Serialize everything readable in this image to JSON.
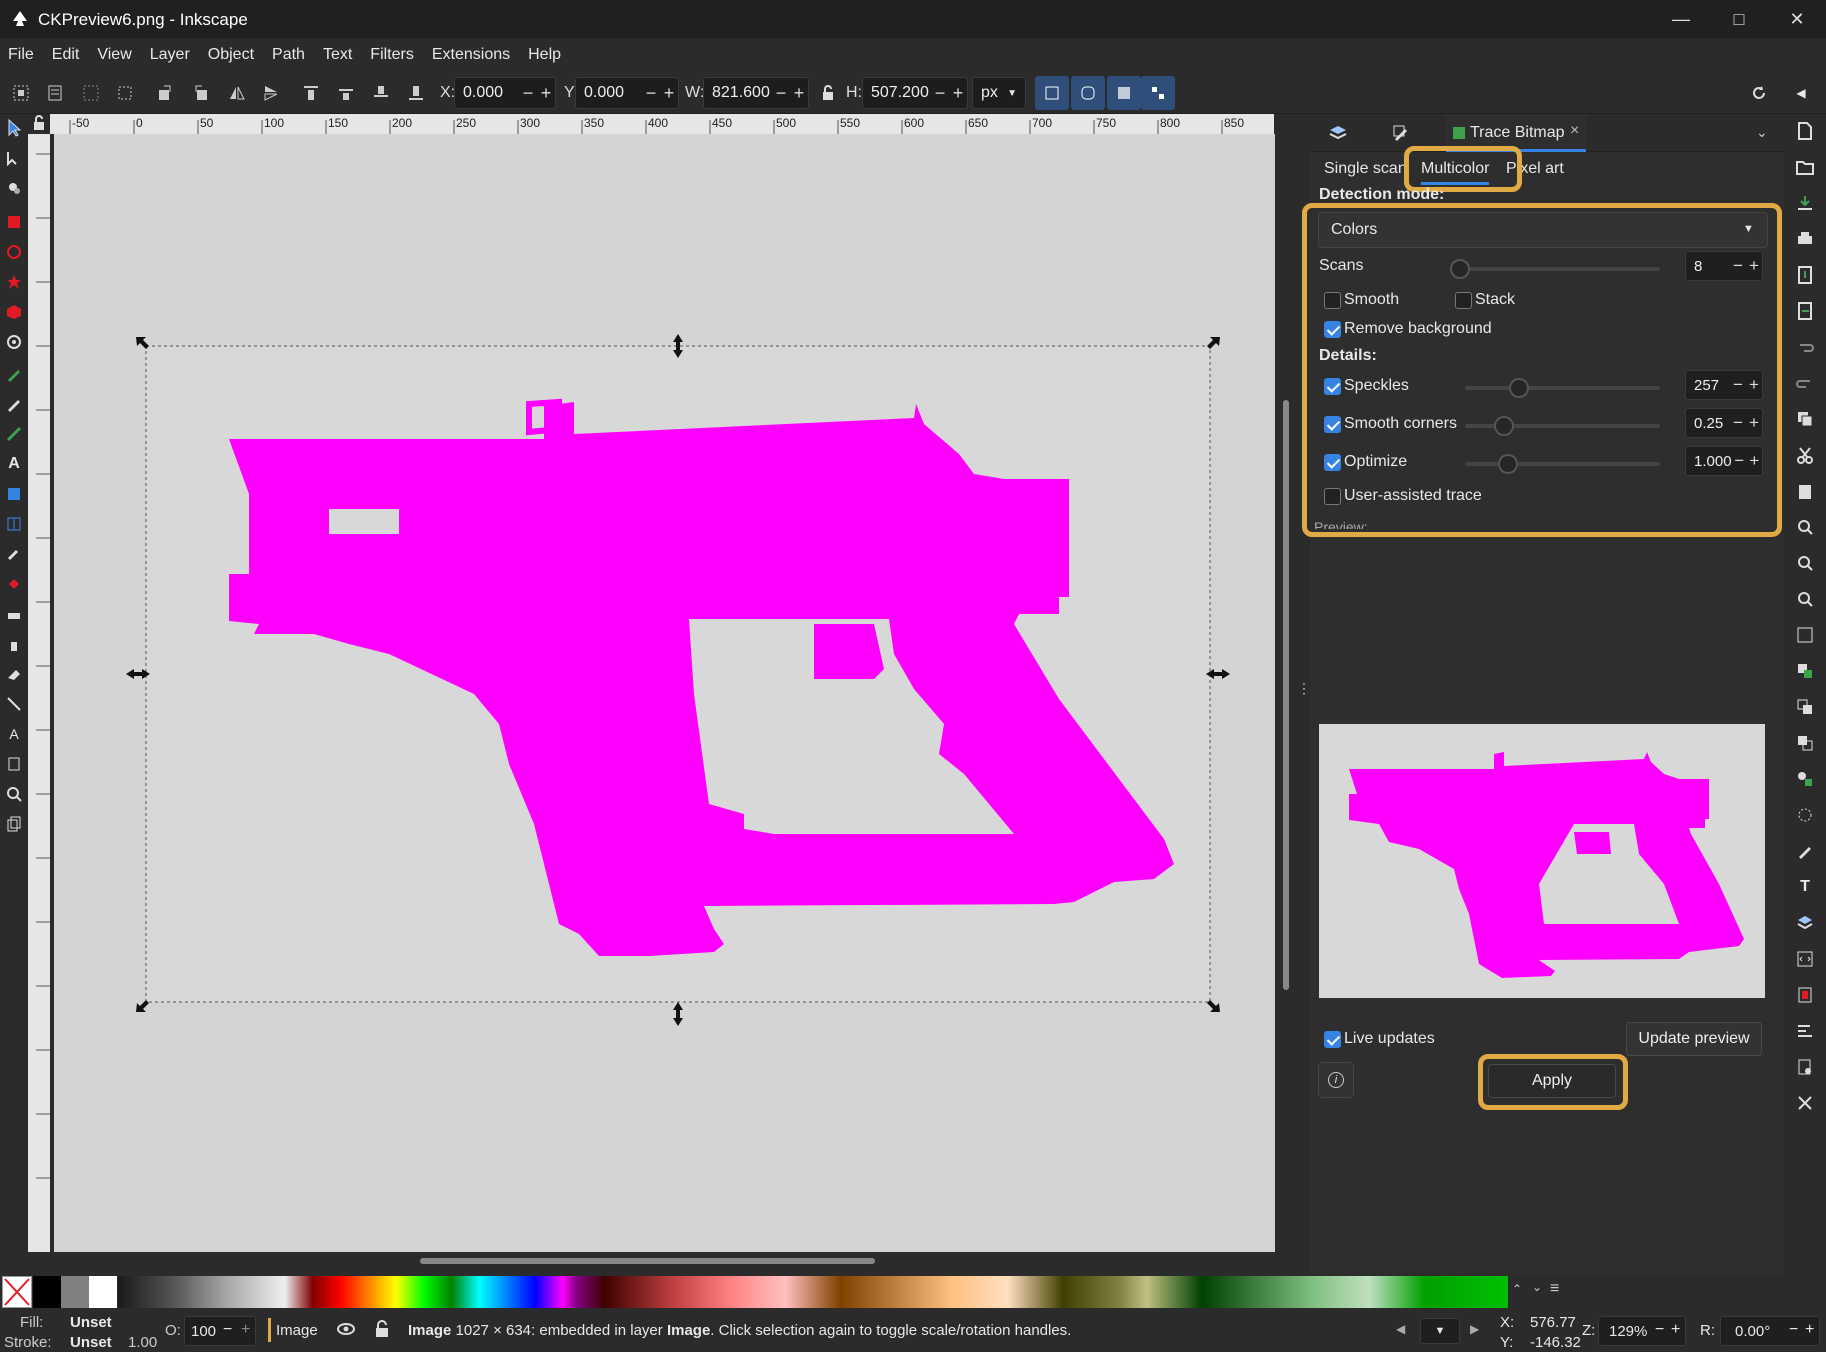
{
  "window": {
    "title": "CKPreview6.png - Inkscape",
    "icons": [
      "inkscape-logo-icon",
      "minimize-icon",
      "maximize-icon",
      "close-icon"
    ]
  },
  "menu": [
    "File",
    "Edit",
    "View",
    "Layer",
    "Object",
    "Path",
    "Text",
    "Filters",
    "Extensions",
    "Help"
  ],
  "toolbar": {
    "x_label": "X:",
    "x_value": "0.000",
    "y_label": "Y:",
    "y_value": "0.000",
    "w_label": "W:",
    "w_value": "821.600",
    "h_label": "H:",
    "h_value": "507.200",
    "unit": "px",
    "minus": "−",
    "plus": "+"
  },
  "ruler": {
    "h_ticks": [
      "-50",
      "0",
      "50",
      "100",
      "150",
      "200",
      "250",
      "300",
      "350",
      "400",
      "450",
      "500",
      "550",
      "600",
      "650",
      "700",
      "750",
      "800",
      "850"
    ],
    "v_ticks": [
      "150",
      "100",
      "50",
      "0",
      "50",
      "100",
      "150",
      "200",
      "250",
      "300",
      "350",
      "400",
      "450",
      "500",
      "550",
      "600",
      "650"
    ]
  },
  "panel": {
    "tab_icons": [
      "layers-icon",
      "edit-icon"
    ],
    "active_tab": "Trace Bitmap",
    "close": "×",
    "mode_tabs": [
      "Single scan",
      "Multicolor",
      "Pixel art"
    ],
    "selected_mode": "Multicolor",
    "detection_label": "Detection mode:",
    "detection_value": "Colors",
    "scans_label": "Scans",
    "scans_value": "8",
    "smooth_label": "Smooth",
    "smooth_checked": false,
    "stack_label": "Stack",
    "stack_checked": false,
    "remove_bg_label": "Remove background",
    "remove_bg_checked": true,
    "details_label": "Details:",
    "speckles_label": "Speckles",
    "speckles_value": "257",
    "smooth_corners_label": "Smooth corners",
    "smooth_corners_value": "0.25",
    "optimize_label": "Optimize",
    "optimize_value": "1.000",
    "user_assisted_label": "User-assisted trace",
    "user_assisted_checked": false,
    "preview_label": "Preview:",
    "live_updates_label": "Live updates",
    "live_updates_checked": true,
    "update_preview_label": "Update preview",
    "apply_label": "Apply",
    "highlight_color": "#e2aa45"
  },
  "status": {
    "fill_label": "Fill:",
    "fill_value": "Unset",
    "stroke_label": "Stroke:",
    "stroke_value": "Unset",
    "stroke_width": "1.00",
    "opacity_label": "O:",
    "opacity_value": "100",
    "layer_name": "Image",
    "message_bold": "Image",
    "message_rest": " 1027 × 634: embedded in layer ",
    "message_layer": "Image",
    "message_tail": ". Click selection again to toggle scale/rotation handles.",
    "x_label": "X:",
    "x_value": "576.77",
    "y_label": "Y:",
    "y_value": "-146.32",
    "zoom_label": "Z:",
    "zoom_value": "129%",
    "rotate_label": "R:",
    "rotate_value": "0.00°"
  },
  "colors": {
    "magenta": "#ff00ff",
    "canvas": "#d4d4d4",
    "accent": "#3584e4"
  }
}
